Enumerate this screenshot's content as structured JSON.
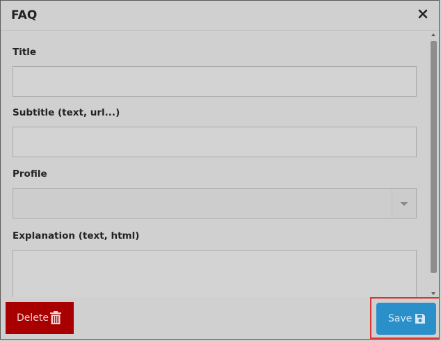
{
  "dialog": {
    "title": "FAQ"
  },
  "form": {
    "title_label": "Title",
    "title_value": "",
    "subtitle_label": "Subtitle (text, url...)",
    "subtitle_value": "",
    "profile_label": "Profile",
    "profile_selected": "",
    "explanation_label": "Explanation (text, html)",
    "explanation_value": ""
  },
  "footer": {
    "delete_label": "Delete",
    "save_label": "Save"
  },
  "colors": {
    "delete_button": "#a80000",
    "save_button": "#2b8fc9",
    "highlight": "#d93636",
    "background": "#d0d0d0"
  },
  "icons": {
    "close": "close-icon",
    "delete": "trash-icon",
    "save": "floppy-disk-icon",
    "select": "caret-down-icon"
  }
}
